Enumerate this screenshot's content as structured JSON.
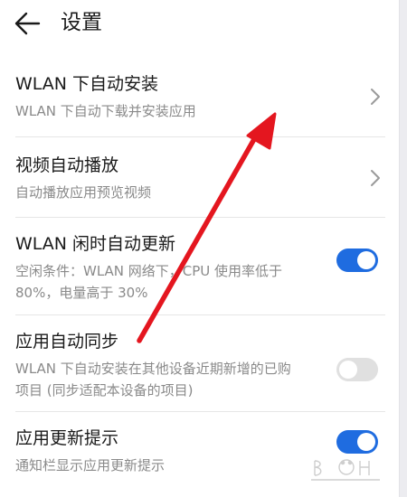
{
  "header": {
    "title": "设置",
    "back_icon": "arrow-left-icon"
  },
  "settings": [
    {
      "title": "WLAN 下自动安装",
      "subtitle": "WLAN 下自动下载并安装应用",
      "control": "chevron"
    },
    {
      "title": "视频自动播放",
      "subtitle": "自动播放应用预览视频",
      "control": "chevron"
    },
    {
      "title": "WLAN 闲时自动更新",
      "subtitle": "空闲条件：WLAN 网络下，CPU 使用率低于 80%，电量高于 30%",
      "control": "toggle",
      "toggle_on": true
    },
    {
      "title": "应用自动同步",
      "subtitle": "WLAN 下自动安装在其他设备近期新增的已购项目 (同步适配本设备的项目)",
      "control": "toggle",
      "toggle_on": false
    },
    {
      "title": "应用更新提示",
      "subtitle": "通知栏显示应用更新提示",
      "control": "toggle",
      "toggle_on": true
    }
  ],
  "colors": {
    "toggle_on": "#1f6ce0",
    "toggle_off": "#e0e0e0",
    "annotation_arrow": "#e4161f"
  },
  "overlay": {
    "annotation": "red-arrow-pointing-to-first-item"
  }
}
